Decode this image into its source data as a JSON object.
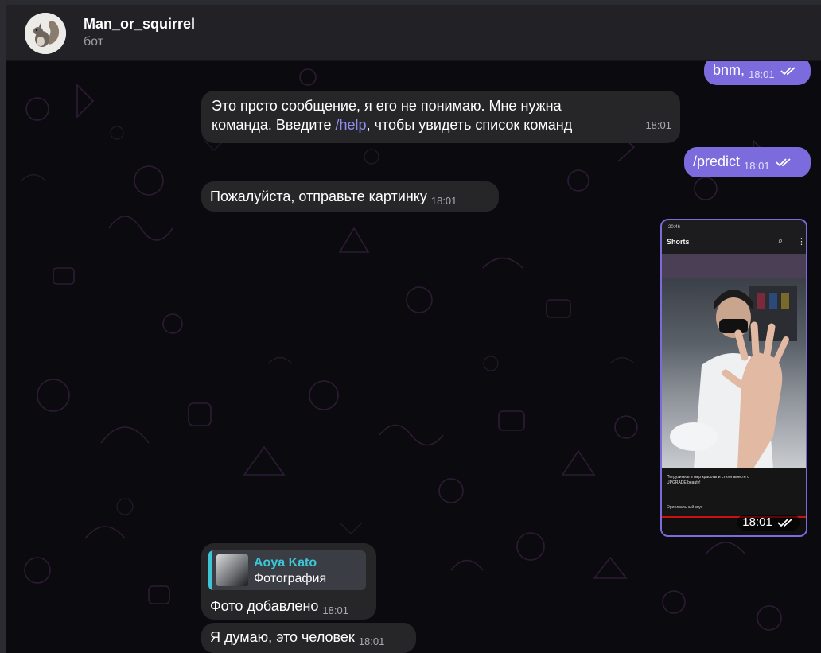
{
  "header": {
    "title": "Man_or_squirrel",
    "subtitle": "бот",
    "avatar_icon": "squirrel-avatar"
  },
  "colors": {
    "outgoing_bubble": "#7b6bdc",
    "incoming_bubble": "#262629",
    "link": "#8f8cf0",
    "reply_accent": "#3cc6d6",
    "background": "#0b0a0e"
  },
  "messages": [
    {
      "direction": "out",
      "text": "bnm,",
      "time": "18:01",
      "status_icon": "double-check-icon"
    },
    {
      "direction": "in",
      "text_line1": "Это прсто сообщение, я его не понимаю. Мне нужна",
      "text_line2_before": "команда. Введите ",
      "link": "/help",
      "text_line2_after": ", чтобы увидеть список команд",
      "time": "18:01"
    },
    {
      "direction": "out",
      "text": "/predict",
      "time": "18:01",
      "status_icon": "double-check-icon"
    },
    {
      "direction": "in",
      "text": "Пожалуйста, отправьте картинку",
      "time": "18:01"
    },
    {
      "direction": "out",
      "type": "photo",
      "time": "18:01",
      "status_icon": "double-check-icon",
      "screenshot": {
        "status_bar": "20:46",
        "heading": "Shorts",
        "caption": "Погрузитесь в мир красоты и стиля вместе с UPGRADE beauty!",
        "sound": "Оригинальный звук"
      }
    },
    {
      "direction": "in",
      "reply_to_name": "Aoya Kato",
      "reply_to_text": "Фотография",
      "text": "Фото добавлено",
      "time": "18:01"
    },
    {
      "direction": "in",
      "text": "Я думаю, это человек",
      "time": "18:01"
    }
  ]
}
